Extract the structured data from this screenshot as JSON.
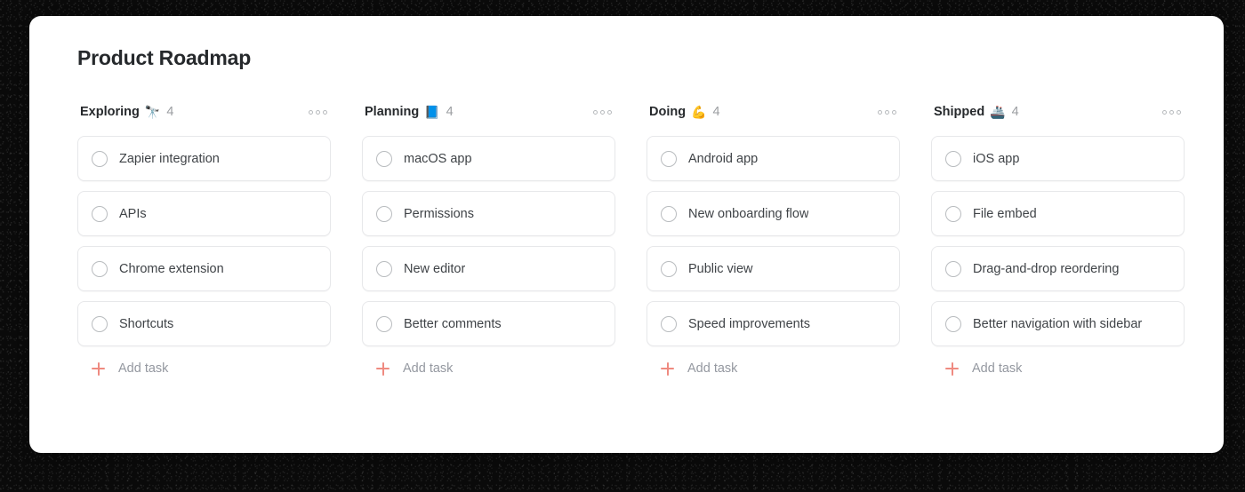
{
  "board": {
    "title": "Product Roadmap",
    "accent_color": "#ef8a80",
    "card_background": "#ffffff",
    "frame_color": "#0a0a0a",
    "columns": [
      {
        "name": "Exploring",
        "emoji": "🔭",
        "emoji_name": "telescope",
        "count": "4",
        "menu_icon": "more-horizontal-icon",
        "add_task_label": "Add task",
        "tasks": [
          {
            "label": "Zapier integration",
            "checked": false
          },
          {
            "label": "APIs",
            "checked": false
          },
          {
            "label": "Chrome extension",
            "checked": false
          },
          {
            "label": "Shortcuts",
            "checked": false
          }
        ]
      },
      {
        "name": "Planning",
        "emoji": "📘",
        "emoji_name": "blue-book",
        "count": "4",
        "menu_icon": "more-horizontal-icon",
        "add_task_label": "Add task",
        "tasks": [
          {
            "label": "macOS app",
            "checked": false
          },
          {
            "label": "Permissions",
            "checked": false
          },
          {
            "label": "New editor",
            "checked": false
          },
          {
            "label": "Better comments",
            "checked": false
          }
        ]
      },
      {
        "name": "Doing",
        "emoji": "💪",
        "emoji_name": "flexed-biceps",
        "count": "4",
        "menu_icon": "more-horizontal-icon",
        "add_task_label": "Add task",
        "tasks": [
          {
            "label": "Android app",
            "checked": false
          },
          {
            "label": "New onboarding flow",
            "checked": false
          },
          {
            "label": "Public view",
            "checked": false
          },
          {
            "label": "Speed improvements",
            "checked": false
          }
        ]
      },
      {
        "name": "Shipped",
        "emoji": "🚢",
        "emoji_name": "ship",
        "count": "4",
        "menu_icon": "more-horizontal-icon",
        "add_task_label": "Add task",
        "tasks": [
          {
            "label": "iOS app",
            "checked": false
          },
          {
            "label": "File embed",
            "checked": false
          },
          {
            "label": "Drag-and-drop reordering",
            "checked": false
          },
          {
            "label": "Better navigation with sidebar",
            "checked": false
          }
        ]
      }
    ]
  }
}
